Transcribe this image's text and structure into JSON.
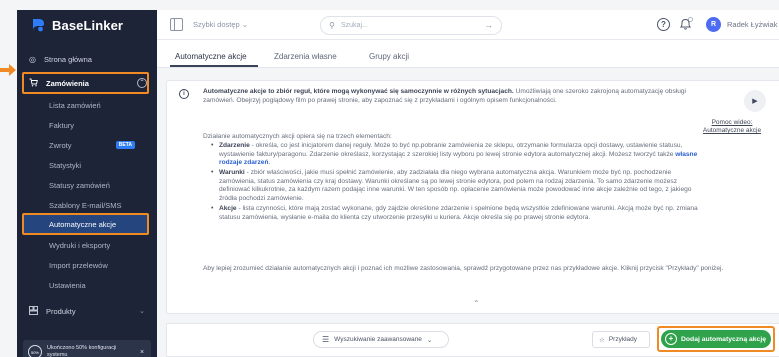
{
  "app": {
    "name": "BaseLinker"
  },
  "colors": {
    "sidebar_bg": "#1d2438",
    "active_item": "#24457e",
    "highlight": "#f08a24",
    "primary_green": "#31a24c",
    "beta": "#2e7df6",
    "avatar": "#4e6cf1"
  },
  "sidebar": {
    "home": "Strona główna",
    "orders": {
      "label": "Zamówienia",
      "toggle": "⌃"
    },
    "sub_items": [
      "Lista zamówień",
      "Faktury",
      "Zwroty",
      "Statystyki",
      "Statusy zamówień",
      "Szablony E-mail/SMS",
      "Automatyczne akcje",
      "Wydruki i eksporty",
      "Import przelewów",
      "Ustawienia"
    ],
    "beta_badge": "BETA",
    "products": "Produkty",
    "footer": {
      "badge": "50%",
      "text": "Ukończono 50% konfiguracji systemu",
      "close": "×"
    }
  },
  "topbar": {
    "quick_access": "Szybki dostęp",
    "search_placeholder": "Szukaj...",
    "help": "?",
    "avatar_letter": "R",
    "user_name": "Radek Łyżwiak"
  },
  "tabs": [
    "Automatyczne akcje",
    "Zdarzenia własne",
    "Grupy akcji"
  ],
  "info": {
    "p1_bold": "Automatyczne akcje to zbiór reguł, które mogą wykonywać się samoczynnie w różnych sytuacjach.",
    "p1_rest": " Umożliwiają one szeroko zakrojoną automatyzację obsługi zamówień. Obejrzyj poglądowy film po prawej stronie, aby zapoznać się z przykładami i ogólnym opisem funkcjonalności.",
    "p2": "Działanie automatycznych akcji opiera się na trzech elementach:",
    "b1_bold": "Zdarzenie",
    "b1_text": " - określa, co jest inicjatorem danej reguły. Może to być np.pobranie zamówienia ze sklepu, otrzymanie formularza opcji dostawy, ustawienie statusu, wystawienie faktury/paragonu. Zdarzenie określasz, korzystając z szerokiej listy wyboru po lewej stronie edytora automatycznej akcji. Możesz tworzyć także ",
    "b1_link": "własne rodzaje zdarzeń",
    "b1_end": ".",
    "b2_bold": "Warunki",
    "b2_text": " - zbiór właściwości, jakie musi spełnić zamówienie, aby zadziałała dla niego wybrana automatyczna akcja. Warunkiem może być np. pochodzenie zamówienia, status zamówienia czy kraj dostawy. Warunki określane są po lewej stronie edytora, pod polem na rodzaj zdarzenia. To samo zdarzenie możesz definiować kilkukrotnie, za każdym razem podając inne warunki. W ten sposób np. opłacenie zamówienia może powodować inne akcje zależnie od tego, z jakiego źródła pochodzi zamówienie.",
    "b3_bold": "Akcje",
    "b3_text": " - lista czynności, które mają zostać wykonane, gdy zajdzie określone zdarzenie i spełnione będą wszystkie zdefiniowane warunki. Akcją może być np. zmiana statusu zamówienia, wysłanie e-maila do klienta czy utworzenie przesyłki u kuriera. Akcje określa się po prawej stronie edytora.",
    "p3": "Aby lepiej zrozumieć działanie automatycznych akcji i poznać ich możliwe zastosowania, sprawdź przygotowane przez nas przykładowe akcje. Kliknij przycisk \"Przykłady\" poniżej.",
    "help_video": "Pomoc wideo: Automatyczne akcje"
  },
  "toolbar": {
    "advanced_search": "Wyszukiwanie zaawansowane",
    "examples": "Przykłady",
    "add": "Dodaj automatyczną akcję"
  }
}
